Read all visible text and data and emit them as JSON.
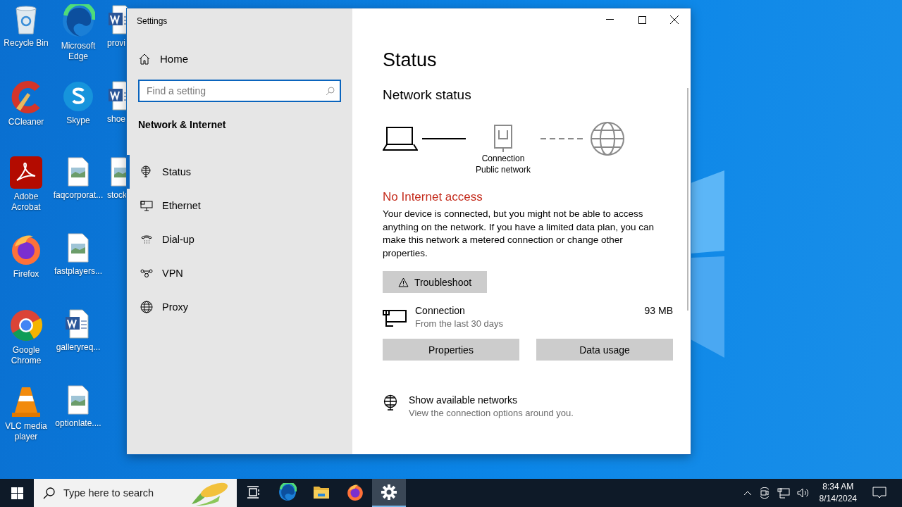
{
  "desktop": {
    "columns": [
      [
        {
          "label": "Recycle Bin",
          "kind": "recycle"
        },
        {
          "label": "CCleaner",
          "kind": "ccleaner"
        },
        {
          "label": "Adobe Acrobat",
          "kind": "acrobat"
        },
        {
          "label": "Firefox",
          "kind": "firefox"
        },
        {
          "label": "Google Chrome",
          "kind": "chrome"
        },
        {
          "label": "VLC media player",
          "kind": "vlc"
        }
      ],
      [
        {
          "label": "Microsoft Edge",
          "kind": "edge"
        },
        {
          "label": "Skype",
          "kind": "skype"
        },
        {
          "label": "faqcorporat...",
          "kind": "image"
        },
        {
          "label": "fastplayers...",
          "kind": "image"
        },
        {
          "label": "galleryreq...",
          "kind": "word"
        },
        {
          "label": "optionlate....",
          "kind": "image"
        }
      ],
      [
        {
          "label": "provi",
          "kind": "word"
        },
        {
          "label": "shoe",
          "kind": "word"
        },
        {
          "label": "stock",
          "kind": "image"
        }
      ]
    ]
  },
  "window": {
    "title": "Settings",
    "nav": {
      "home": "Home",
      "search": {
        "placeholder": "Find a setting"
      },
      "section": "Network & Internet",
      "items": [
        {
          "label": "Status",
          "kind": "status",
          "selected": true
        },
        {
          "label": "Ethernet",
          "kind": "ethernet",
          "selected": false
        },
        {
          "label": "Dial-up",
          "kind": "dialup",
          "selected": false
        },
        {
          "label": "VPN",
          "kind": "vpn",
          "selected": false
        },
        {
          "label": "Proxy",
          "kind": "proxy",
          "selected": false
        }
      ]
    },
    "content": {
      "title": "Status",
      "subtitle": "Network status",
      "diagram": {
        "labels": [
          "Connection",
          "Public network"
        ]
      },
      "alert": "No Internet access",
      "description": "Your device is connected, but you might not be able to access anything on the network. If you have a limited data plan, you can make this network a metered connection or change other properties.",
      "troubleshoot": "Troubleshoot",
      "connection": {
        "name": "Connection",
        "detail": "From the last 30 days",
        "usage": "93 MB"
      },
      "buttons": [
        "Properties",
        "Data usage"
      ],
      "link": {
        "title": "Show available networks",
        "detail": "View the connection options around you."
      }
    }
  },
  "taskbar": {
    "search": {
      "placeholder": "Type here to search"
    },
    "apps": [
      {
        "kind": "taskview",
        "selected": false
      },
      {
        "kind": "edge",
        "selected": false
      },
      {
        "kind": "explorer",
        "selected": false
      },
      {
        "kind": "firefox",
        "selected": false
      },
      {
        "kind": "settings",
        "selected": true
      }
    ],
    "time": "8:34 AM",
    "date": "8/14/2024"
  }
}
